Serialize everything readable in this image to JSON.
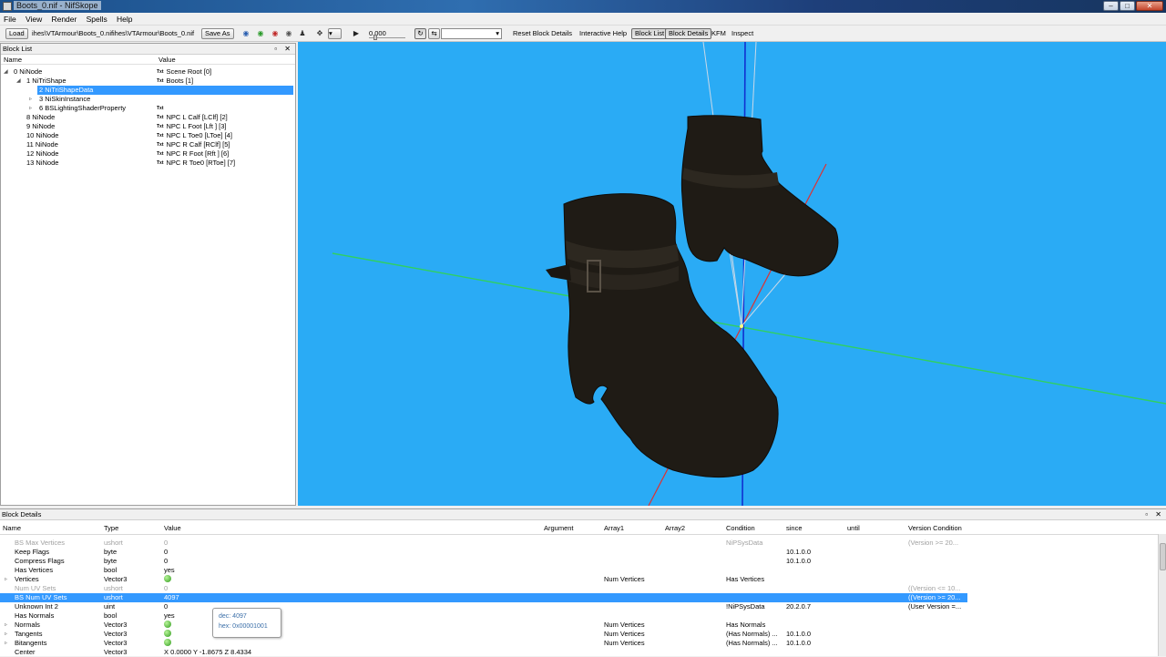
{
  "window": {
    "title": "Boots_0.nif - NifSkope",
    "min": "–",
    "max": "□",
    "close": "✕"
  },
  "menu": [
    "File",
    "View",
    "Render",
    "Spells",
    "Help"
  ],
  "toolbar": {
    "load": "Load",
    "path1": "ihes\\VTArmour\\Boots_0.nif",
    "path2": "ihes\\VTArmour\\Boots_0.nif",
    "save_as": "Save As",
    "time": "0.000",
    "reset_block_details": "Reset Block Details",
    "interactive_help": "Interactive Help",
    "block_list": "Block List",
    "block_details": "Block Details",
    "kfm": "KFM",
    "inspect": "Inspect"
  },
  "block_list": {
    "title": "Block List",
    "controls": "▫ ✕",
    "col_name": "Name",
    "col_value": "Value",
    "txt_tag": "Txt",
    "rows": [
      {
        "name": "0 NiNode",
        "value": "Scene Root [0]",
        "expand": "◢",
        "indent": 0
      },
      {
        "name": "1 NiTriShape",
        "value": "Boots [1]",
        "expand": "◢",
        "indent": 1
      },
      {
        "name": "2 NiTriShapeData",
        "value": "",
        "expand": "",
        "indent": 2,
        "selected": true
      },
      {
        "name": "3 NiSkinInstance",
        "value": "",
        "expand": "▹",
        "indent": 2
      },
      {
        "name": "6 BSLightingShaderProperty",
        "value": "",
        "expand": "▹",
        "indent": 2,
        "txt": true
      },
      {
        "name": "8 NiNode",
        "value": "NPC L Calf [LClf] [2]",
        "expand": "",
        "indent": 1
      },
      {
        "name": "9 NiNode",
        "value": "NPC L Foot [Lft ] [3]",
        "expand": "",
        "indent": 1
      },
      {
        "name": "10 NiNode",
        "value": "NPC L Toe0 [LToe] [4]",
        "expand": "",
        "indent": 1
      },
      {
        "name": "11 NiNode",
        "value": "NPC R Calf [RClf] [5]",
        "expand": "",
        "indent": 1
      },
      {
        "name": "12 NiNode",
        "value": "NPC R Foot [Rft ] [6]",
        "expand": "",
        "indent": 1
      },
      {
        "name": "13 NiNode",
        "value": "NPC R Toe0 [RToe] [7]",
        "expand": "",
        "indent": 1
      }
    ]
  },
  "viewport": {
    "background": "#2aabf5",
    "axis_x_color": "#e03030",
    "axis_y_color": "#30d060",
    "axis_z_color": "#1030d0"
  },
  "block_details": {
    "title": "Block Details",
    "controls": "▫ ✕",
    "columns": [
      "Name",
      "Type",
      "Value",
      "Argument",
      "Array1",
      "Array2",
      "Condition",
      "since",
      "until",
      "Version Condition"
    ],
    "rows": [
      {
        "name": "BS Max Vertices",
        "type": "ushort",
        "value": "0",
        "array1": "",
        "condition": "NiPSysData",
        "since": "",
        "vercond": "(Version >= 20...",
        "grey": true
      },
      {
        "name": "Keep Flags",
        "type": "byte",
        "value": "0",
        "array1": "",
        "condition": "",
        "since": "10.1.0.0",
        "vercond": ""
      },
      {
        "name": "Compress Flags",
        "type": "byte",
        "value": "0",
        "array1": "",
        "condition": "",
        "since": "10.1.0.0",
        "vercond": ""
      },
      {
        "name": "Has Vertices",
        "type": "bool",
        "value": "yes",
        "array1": "",
        "condition": "",
        "since": "",
        "vercond": ""
      },
      {
        "name": "Vertices",
        "type": "Vector3",
        "value": "",
        "gem": true,
        "expand": "▹",
        "array1": "Num Vertices",
        "condition": "Has Vertices",
        "since": "",
        "vercond": ""
      },
      {
        "name": "Num UV Sets",
        "type": "ushort",
        "value": "0",
        "array1": "",
        "condition": "",
        "since": "",
        "vercond": "((Version <= 10...",
        "grey": true
      },
      {
        "name": "BS Num UV Sets",
        "type": "ushort",
        "value": "4097",
        "array1": "",
        "condition": "",
        "since": "",
        "vercond": "((Version >= 20...",
        "selected": true
      },
      {
        "name": "Unknown Int 2",
        "type": "uint",
        "value": "0",
        "array1": "",
        "condition": "!NiPSysData",
        "since": "20.2.0.7",
        "vercond": "(User Version =..."
      },
      {
        "name": "Has Normals",
        "type": "bool",
        "value": "yes",
        "array1": "",
        "condition": "",
        "since": "",
        "vercond": ""
      },
      {
        "name": "Normals",
        "type": "Vector3",
        "value": "",
        "gem": true,
        "expand": "▹",
        "array1": "Num Vertices",
        "condition": "Has Normals",
        "since": "",
        "vercond": ""
      },
      {
        "name": "Tangents",
        "type": "Vector3",
        "value": "",
        "gem": true,
        "expand": "▹",
        "array1": "Num Vertices",
        "condition": "(Has Normals) ...",
        "since": "10.1.0.0",
        "vercond": ""
      },
      {
        "name": "Bitangents",
        "type": "Vector3",
        "value": "",
        "gem": true,
        "expand": "▹",
        "array1": "Num Vertices",
        "condition": "(Has Normals) ...",
        "since": "10.1.0.0",
        "vercond": ""
      },
      {
        "name": "Center",
        "type": "Vector3",
        "value": "X 0.0000 Y -1.8675 Z 8.4334",
        "array1": "",
        "condition": "",
        "since": "",
        "vercond": ""
      }
    ]
  },
  "tooltip": {
    "dec": "dec: 4097",
    "hex": "hex: 0x00001001"
  }
}
